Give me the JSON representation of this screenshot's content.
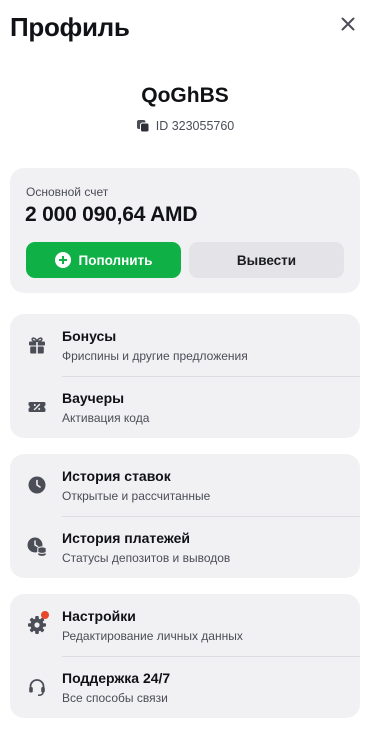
{
  "header": {
    "title": "Профиль",
    "close_icon": "close-icon"
  },
  "user": {
    "username": "QoGhBS",
    "id_text": "ID 323055760",
    "copy_icon": "copy-icon"
  },
  "account": {
    "label": "Основной счет",
    "balance": "2 000 090,64 AMD",
    "deposit_label": "Пополнить",
    "withdraw_label": "Вывести",
    "deposit_color": "#0fb146"
  },
  "groups": [
    {
      "items": [
        {
          "title": "Бонусы",
          "subtitle": "Фриспины и другие предложения",
          "icon": "gift-icon"
        },
        {
          "title": "Ваучеры",
          "subtitle": "Активация кода",
          "icon": "voucher-icon"
        }
      ]
    },
    {
      "items": [
        {
          "title": "История ставок",
          "subtitle": "Открытые и рассчитанные",
          "icon": "clock-icon"
        },
        {
          "title": "История платежей",
          "subtitle": "Статусы депозитов и выводов",
          "icon": "payment-history-icon"
        }
      ]
    },
    {
      "items": [
        {
          "title": "Настройки",
          "subtitle": "Редактирование личных данных",
          "icon": "gear-icon",
          "badge_color": "#e8472b"
        },
        {
          "title": "Поддержка 24/7",
          "subtitle": "Все способы связи",
          "icon": "headset-icon"
        }
      ]
    }
  ]
}
